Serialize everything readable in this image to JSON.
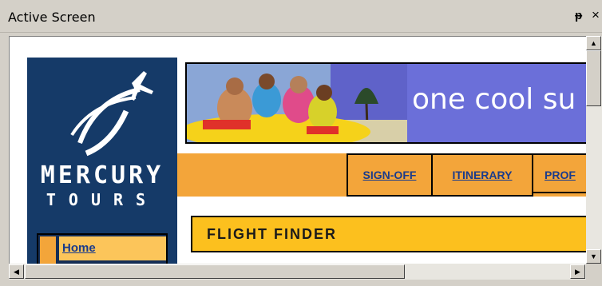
{
  "panel": {
    "title": "Active Screen",
    "pin_glyph": "ᵽ",
    "close_glyph": "×"
  },
  "logo": {
    "line1": "MERCURY",
    "line2": "TOURS",
    "icon": "plane-swoosh-logo"
  },
  "banner": {
    "text": "one cool su",
    "photo": "kids-on-inflatable-raft-photo"
  },
  "nav": {
    "items": [
      {
        "label": "SIGN-OFF"
      },
      {
        "label": "ITINERARY"
      },
      {
        "label": "PROF"
      }
    ]
  },
  "sidebar": {
    "home_label": "Home"
  },
  "content": {
    "section_title": "FLIGHT FINDER"
  },
  "scrollbars": {
    "up_icon": "▲",
    "down_icon": "▼",
    "left_icon": "◀",
    "right_icon": "▶"
  },
  "colors": {
    "sidebar": "#153a68",
    "nav_orange": "#f3a53a",
    "flight_finder_yellow": "#fcc01e",
    "banner_blue": "#6b6fd9",
    "link_blue": "#1a3b8c"
  }
}
